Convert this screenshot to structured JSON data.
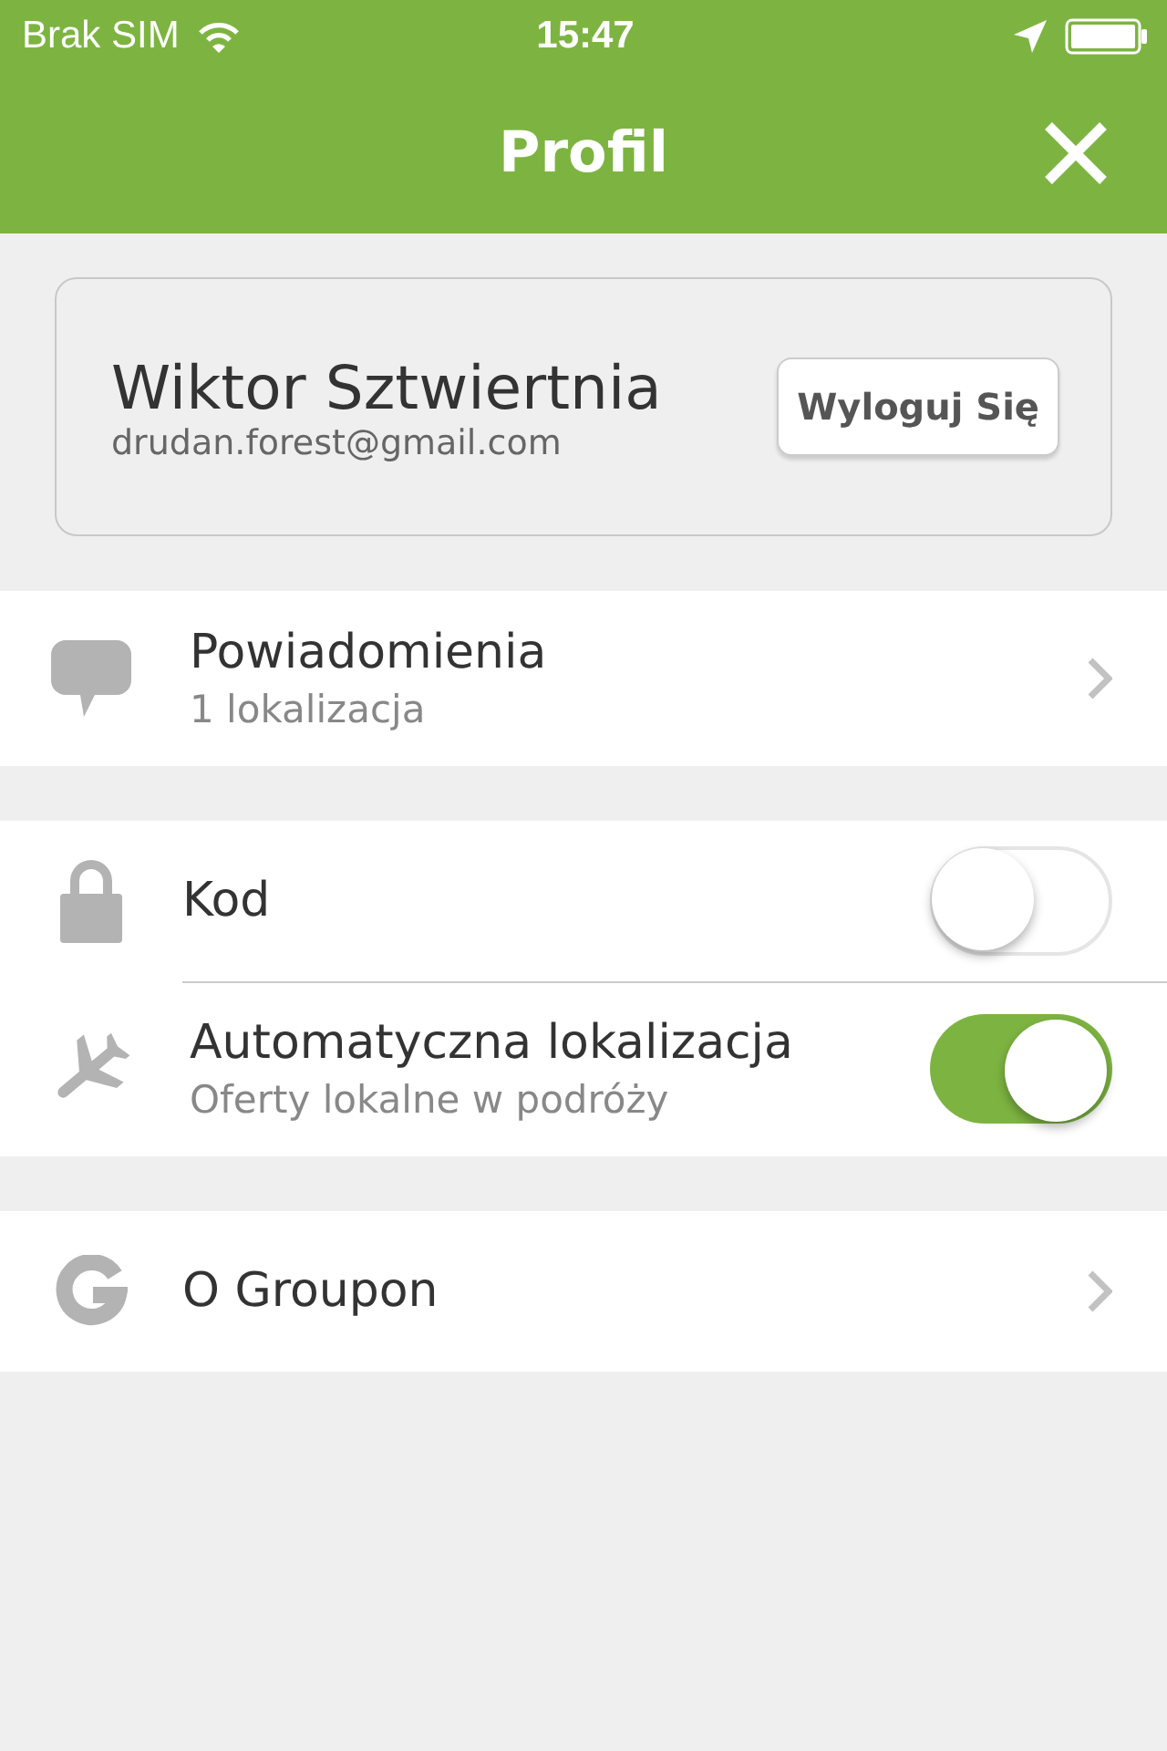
{
  "status_bar": {
    "carrier": "Brak SIM",
    "time": "15:47"
  },
  "header": {
    "title": "Profil"
  },
  "profile": {
    "name": "Wiktor Sztwiertnia",
    "email": "drudan.forest@gmail.com",
    "logout_button": "Wyloguj Się"
  },
  "sections": [
    {
      "rows": [
        {
          "kind": "link",
          "title": "Powiadomienia",
          "subtitle": "1 lokalizacja"
        }
      ]
    },
    {
      "rows": [
        {
          "kind": "toggle",
          "title": "Kod",
          "on": false
        },
        {
          "kind": "toggle",
          "title": "Automatyczna lokalizacja",
          "subtitle": "Oferty lokalne w podróży",
          "on": true
        }
      ]
    },
    {
      "rows": [
        {
          "kind": "link",
          "title": "O Groupon"
        }
      ]
    }
  ]
}
